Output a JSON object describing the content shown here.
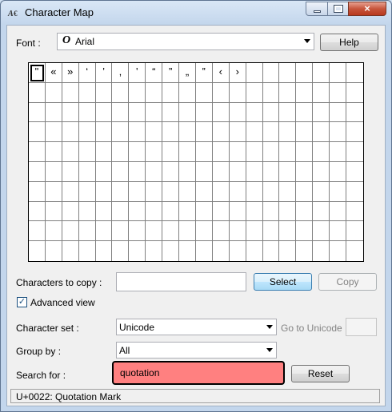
{
  "window": {
    "title": "Character Map",
    "app_icon": "character-map-icon",
    "close_symbol": "×"
  },
  "font": {
    "label": "Font :",
    "value": "Arial",
    "help_label": "Help"
  },
  "grid": {
    "characters": [
      "\"",
      "«",
      "»",
      "‘",
      "’",
      "‚",
      "‛",
      "“",
      "”",
      "„",
      "‟",
      "‹",
      "›"
    ],
    "rows": 10,
    "cols": 20
  },
  "copy": {
    "label": "Characters to copy :",
    "value": "",
    "select_label": "Select",
    "copy_label": "Copy"
  },
  "advanced": {
    "label": "Advanced view",
    "checked": true,
    "check_glyph": "✓"
  },
  "charset": {
    "label": "Character set :",
    "value": "Unicode",
    "goto_label": "Go to Unicode :",
    "goto_value": ""
  },
  "groupby": {
    "label": "Group by :",
    "value": "All"
  },
  "search": {
    "label": "Search for :",
    "value": "quotation",
    "reset_label": "Reset"
  },
  "status": {
    "text": "U+0022: Quotation Mark"
  },
  "colors": {
    "search_highlight": "#ff8080",
    "title_bar": "#d9e7f6"
  }
}
